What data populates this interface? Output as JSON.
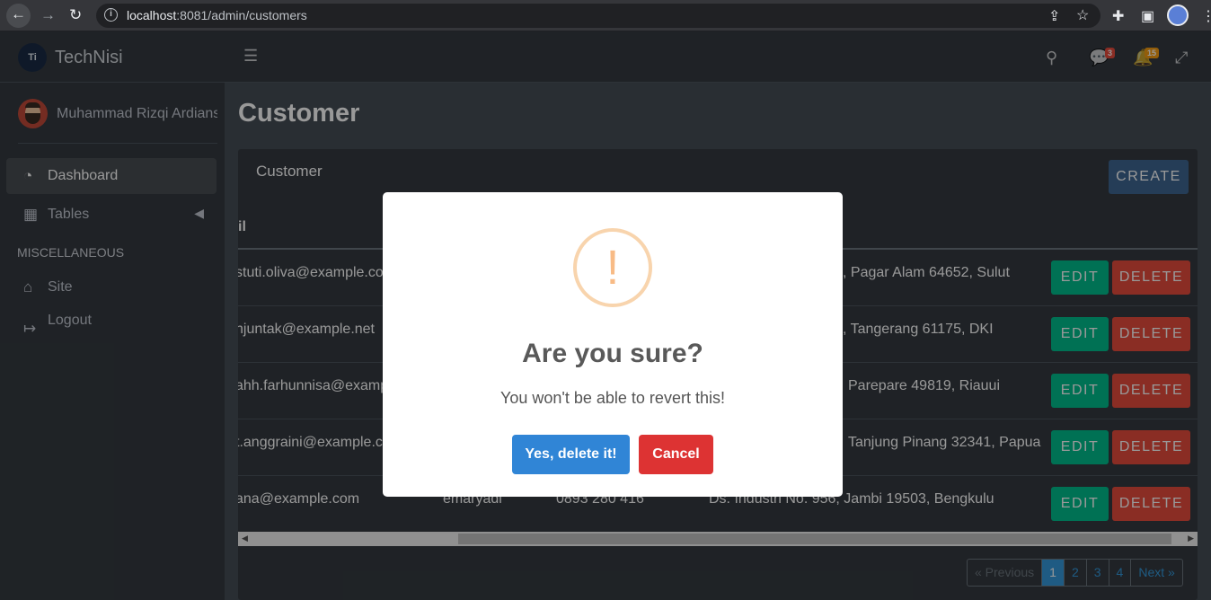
{
  "browser": {
    "url_host": "localhost",
    "url_rest": ":8081/admin/customers"
  },
  "sidebar": {
    "brand": "TechNisi",
    "brand_logo_text": "Ti",
    "user_name": "Muhammad Rizqi Ardians",
    "items": [
      {
        "label": "Dashboard",
        "icon": "tachometer-icon"
      },
      {
        "label": "Tables",
        "icon": "table-icon"
      }
    ],
    "misc_header": "MISCELLANEOUS",
    "misc_items": [
      {
        "label": "Site",
        "icon": "home-icon"
      },
      {
        "label": "Logout",
        "icon": "logout-icon"
      }
    ]
  },
  "navbar": {
    "messages_badge": "3",
    "notifications_badge": "15"
  },
  "page": {
    "title": "Customer",
    "card_title": "Customer",
    "create_label": "CREATE",
    "column_header_partial": "il",
    "edit_label": "EDIT",
    "delete_label": "DELETE"
  },
  "rows": [
    {
      "email": "stuti.oliva@example.com",
      "address": ", Pagar Alam 64652, Sulut"
    },
    {
      "email": "njuntak@example.net",
      "address": ", Tangerang 61175, DKI"
    },
    {
      "email": "ahh.farhunnisa@example.com",
      "address": "Parepare 49819, Riauui"
    },
    {
      "email": "t.anggraini@example.com",
      "address": "Tanjung Pinang 32341, Papua"
    },
    {
      "email": "ana@example.com",
      "username": "emaryadi",
      "phone": "0893 280 416",
      "address": "Ds. Industri No. 956, Jambi 19503, Bengkulu"
    }
  ],
  "pagination": {
    "previous": "« Previous",
    "pages": [
      "1",
      "2",
      "3",
      "4"
    ],
    "next": "Next »"
  },
  "modal": {
    "icon": "!",
    "title": "Are you sure?",
    "text": "You won't be able to revert this!",
    "confirm_label": "Yes, delete it!",
    "cancel_label": "Cancel"
  },
  "colors": {
    "confirm": "#3085d6",
    "cancel": "#dd3333",
    "edit": "#00bc8c",
    "delete": "#e74c3c"
  }
}
